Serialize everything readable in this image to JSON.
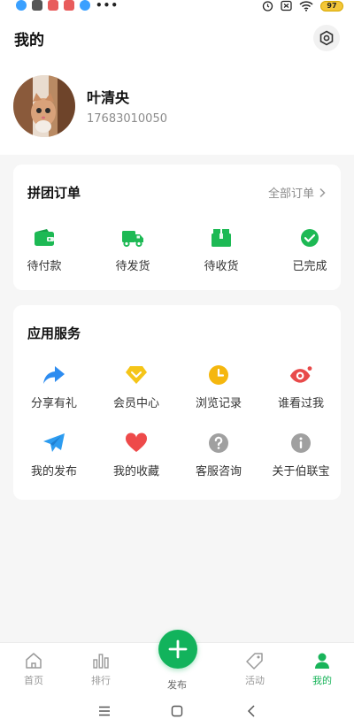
{
  "status_bar": {
    "battery": "97"
  },
  "header": {
    "title": "我的"
  },
  "user": {
    "name": "叶清央",
    "phone": "17683010050"
  },
  "order_card": {
    "title": "拼团订单",
    "more_label": "全部订单",
    "items": [
      {
        "label": "待付款",
        "icon": "wallet-icon",
        "color": "#1db954"
      },
      {
        "label": "待发货",
        "icon": "truck-icon",
        "color": "#1db954"
      },
      {
        "label": "待收货",
        "icon": "package-icon",
        "color": "#1db954"
      },
      {
        "label": "已完成",
        "icon": "check-circle-icon",
        "color": "#1db954"
      }
    ]
  },
  "service_card": {
    "title": "应用服务",
    "items": [
      {
        "label": "分享有礼",
        "icon": "share-icon",
        "color": "#2d8cf0"
      },
      {
        "label": "会员中心",
        "icon": "diamond-icon",
        "color": "#f5c518"
      },
      {
        "label": "浏览记录",
        "icon": "clock-icon",
        "color": "#f5b70e"
      },
      {
        "label": "谁看过我",
        "icon": "eye-icon",
        "color": "#e84a4a"
      },
      {
        "label": "我的发布",
        "icon": "paper-plane-icon",
        "color": "#2d9cf0"
      },
      {
        "label": "我的收藏",
        "icon": "heart-icon",
        "color": "#ee4a4a"
      },
      {
        "label": "客服咨询",
        "icon": "question-icon",
        "color": "#a0a0a0"
      },
      {
        "label": "关于伯联宝",
        "icon": "info-icon",
        "color": "#a0a0a0"
      }
    ]
  },
  "tabbar": {
    "tabs": [
      {
        "label": "首页",
        "icon": "home-icon"
      },
      {
        "label": "排行",
        "icon": "bar-chart-icon"
      },
      {
        "label": "发布",
        "icon": "plus-icon"
      },
      {
        "label": "活动",
        "icon": "tag-icon"
      },
      {
        "label": "我的",
        "icon": "user-icon",
        "active": true
      }
    ]
  },
  "colors": {
    "accent": "#12b35c",
    "muted": "#8c8c8c"
  }
}
